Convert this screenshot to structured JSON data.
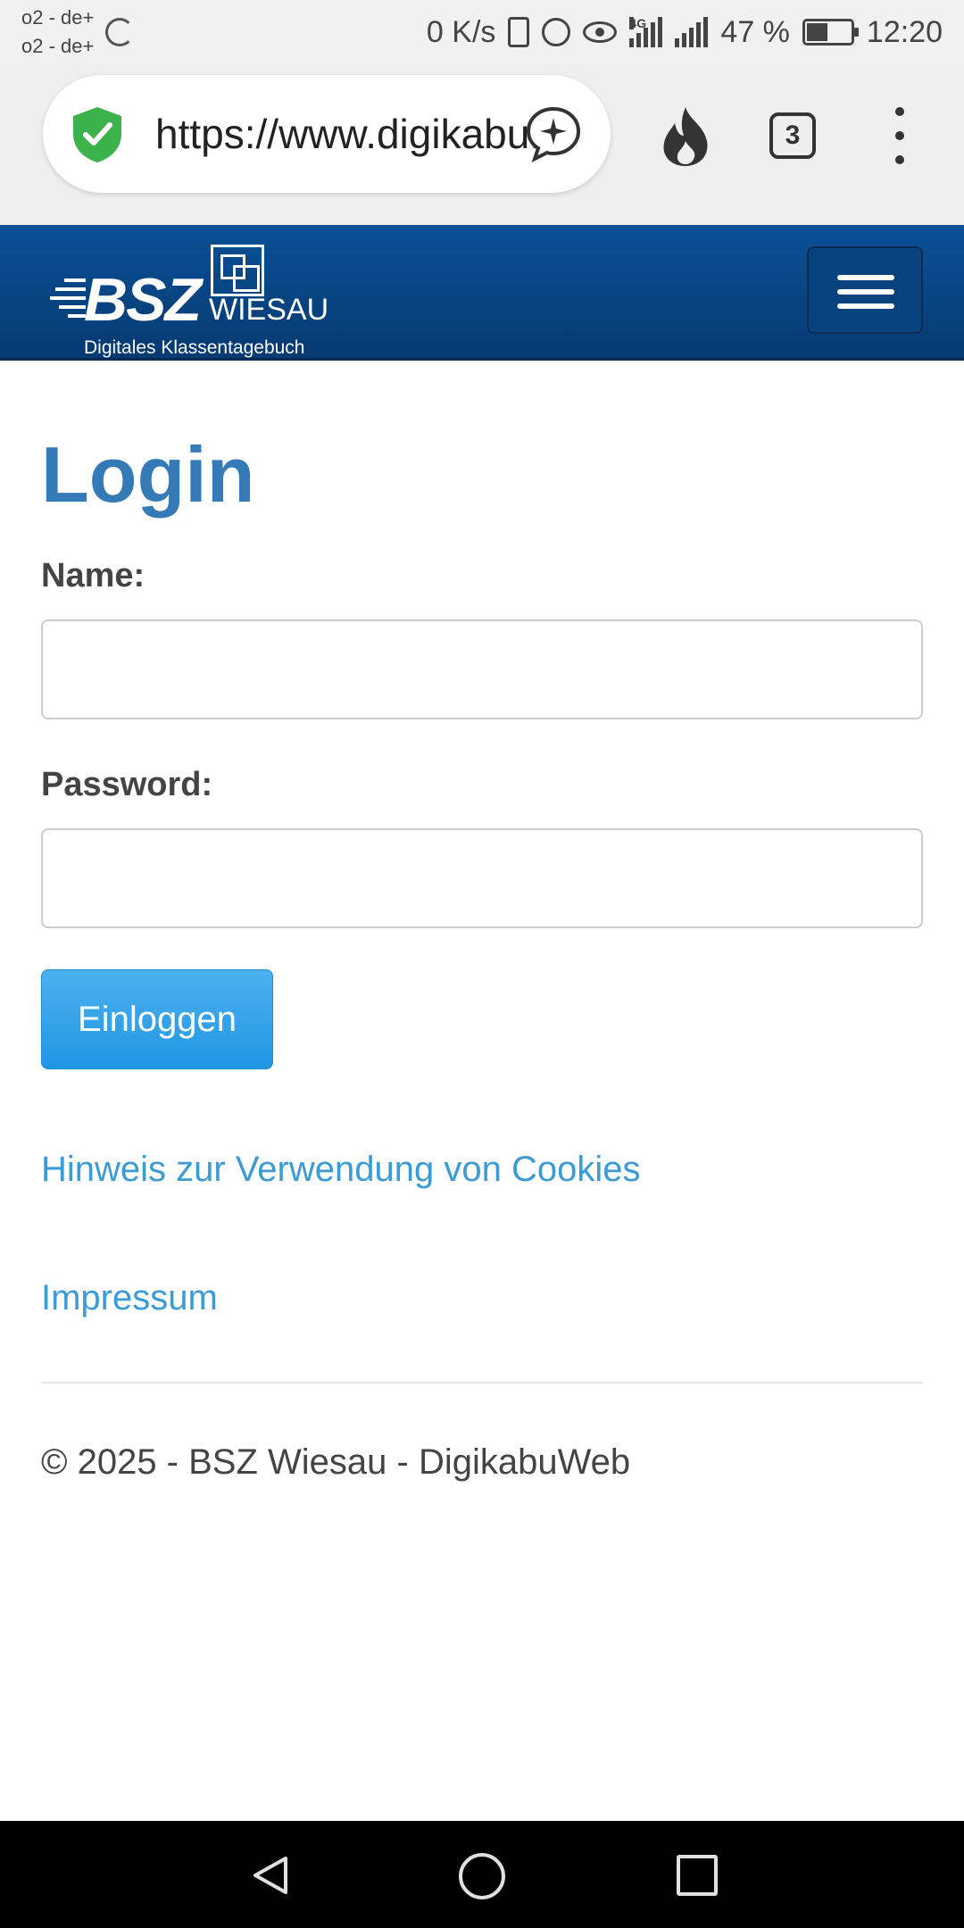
{
  "status_bar": {
    "carrier_1": "o2 - de+",
    "carrier_2": "o2 - de+",
    "net_speed": "0 K/s",
    "network_type": "4G",
    "battery_percent": "47 %",
    "battery_level": 0.47,
    "time": "12:20",
    "icons": [
      "loading-icon",
      "vibrate-icon",
      "alarm-icon",
      "eye-comfort-icon",
      "signal-icon",
      "battery-icon"
    ]
  },
  "browser": {
    "url": "https://www.digikabu.de",
    "tab_count": "3",
    "icons": [
      "security-shield-icon",
      "assistant-bubble-icon",
      "fire-icon",
      "tabs-icon",
      "more-menu-icon"
    ]
  },
  "site_header": {
    "logo_main": "BSZ",
    "logo_location": "WIESAU",
    "logo_subtitle": "Digitales Klassentagebuch",
    "menu_icon": "hamburger-icon"
  },
  "login": {
    "title": "Login",
    "name_label": "Name:",
    "name_value": "",
    "password_label": "Password:",
    "password_value": "",
    "submit_label": "Einloggen"
  },
  "links": {
    "cookies": "Hinweis zur Verwendung von Cookies",
    "imprint": "Impressum"
  },
  "footer": {
    "copyright": "© 2025 - BSZ Wiesau - DigikabuWeb"
  },
  "colors": {
    "header_blue": "#0a5196",
    "title_blue": "#337ab7",
    "link_blue": "#3a9bd5",
    "button_blue": "#2196e3",
    "shield_green": "#3cb34a"
  }
}
